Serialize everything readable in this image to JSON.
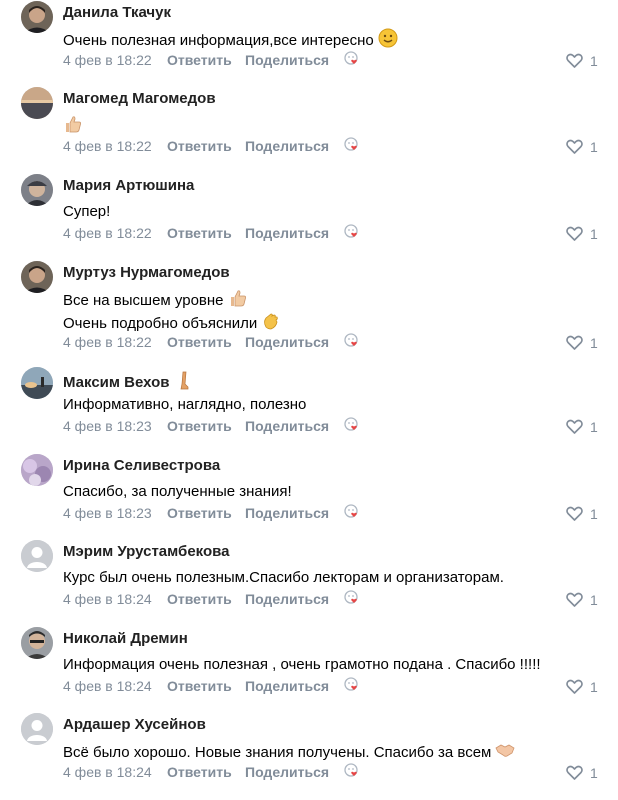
{
  "ui": {
    "reply_label": "Ответить",
    "share_label": "Поделиться"
  },
  "colors": {
    "meta": "#818c99",
    "heart": "#e64646",
    "avatar_placeholder": "#c9ccd1"
  },
  "comments": [
    {
      "author": "Данила Ткачук",
      "lines": [
        "Очень полезная информация,все интересно"
      ],
      "emojis": [
        "slightly-smiling-face"
      ],
      "date": "4 фев в 18:22",
      "likes": "1"
    },
    {
      "author": "Магомед Магомедов",
      "lines": [
        ""
      ],
      "emojis": [
        "thumbs-up"
      ],
      "date": "4 фев в 18:22",
      "likes": "1"
    },
    {
      "author": "Мария Артюшина",
      "lines": [
        "Супер!"
      ],
      "emojis": [],
      "date": "4 фев в 18:22",
      "likes": "1"
    },
    {
      "author": "Муртуз Нурмагомедов",
      "lines": [
        "Все на высшем уровне",
        "Очень подробно объяснили"
      ],
      "emojis": [
        "thumbs-up",
        "clapping-hands"
      ],
      "date": "4 фев в 18:22",
      "likes": "1"
    },
    {
      "author": "Максим Вехов",
      "lines": [
        "Информативно, наглядно, полезно"
      ],
      "emojis": [
        "leg"
      ],
      "date": "4 фев в 18:23",
      "likes": "1"
    },
    {
      "author": "Ирина Селивестрова",
      "lines": [
        "Спасибо, за полученные знания!"
      ],
      "emojis": [],
      "date": "4 фев в 18:23",
      "likes": "1"
    },
    {
      "author": "Мэрим Урустамбекова",
      "lines": [
        "Курс был очень полезным.Спасибо лекторам и организаторам."
      ],
      "emojis": [],
      "date": "4 фев в 18:24",
      "likes": "1"
    },
    {
      "author": "Николай Дремин",
      "lines": [
        "Информация очень полезная , очень грамотно подана . Спасибо !!!!!"
      ],
      "emojis": [],
      "date": "4 фев в 18:24",
      "likes": "1"
    },
    {
      "author": "Ардашер Хусейнов",
      "lines": [
        "Всё было хорошо. Новые знания получены. Спасибо за всем"
      ],
      "emojis": [
        "handshake"
      ],
      "date": "4 фев в 18:24",
      "likes": "1"
    }
  ]
}
